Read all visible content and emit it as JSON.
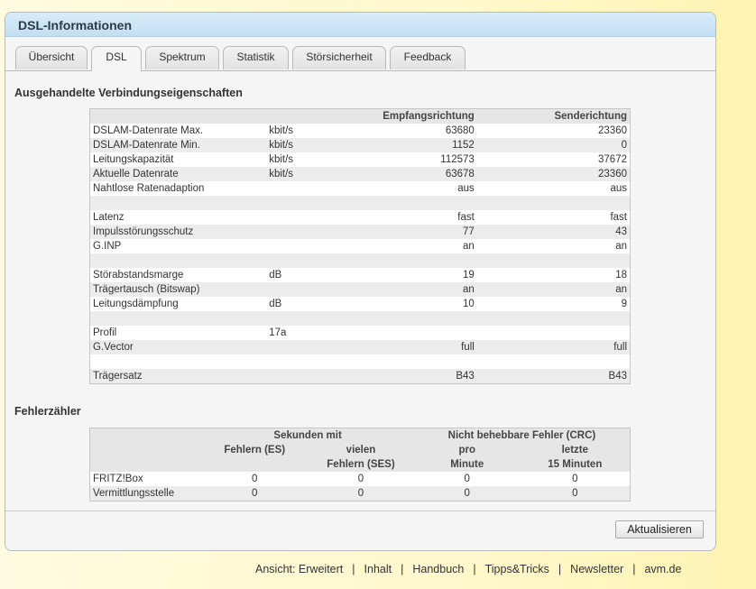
{
  "panel": {
    "title": "DSL-Informationen"
  },
  "tabs": [
    "Übersicht",
    "DSL",
    "Spektrum",
    "Statistik",
    "Störsicherheit",
    "Feedback"
  ],
  "section1": {
    "title": "Ausgehandelte Verbindungseigenschaften",
    "headers": [
      "",
      "",
      "Empfangsrichtung",
      "Senderichtung"
    ],
    "rows": [
      [
        "DSLAM-Datenrate Max.",
        "kbit/s",
        "63680",
        "23360"
      ],
      [
        "DSLAM-Datenrate Min.",
        "kbit/s",
        "1152",
        "0"
      ],
      [
        "Leitungskapazität",
        "kbit/s",
        "112573",
        "37672"
      ],
      [
        "Aktuelle Datenrate",
        "kbit/s",
        "63678",
        "23360"
      ],
      [
        "Nahtlose Ratenadaption",
        "",
        "aus",
        "aus"
      ],
      [
        "",
        "",
        "",
        ""
      ],
      [
        "Latenz",
        "",
        "fast",
        "fast"
      ],
      [
        "Impulsstörungsschutz",
        "",
        "77",
        "43"
      ],
      [
        "G.INP",
        "",
        "an",
        "an"
      ],
      [
        "",
        "",
        "",
        ""
      ],
      [
        "Störabstandsmarge",
        "dB",
        "19",
        "18"
      ],
      [
        "Trägertausch (Bitswap)",
        "",
        "an",
        "an"
      ],
      [
        "Leitungsdämpfung",
        "dB",
        "10",
        "9"
      ],
      [
        "",
        "",
        "",
        ""
      ],
      [
        "Profil",
        "17a",
        "",
        ""
      ],
      [
        "G.Vector",
        "",
        "full",
        "full"
      ],
      [
        "",
        "",
        "",
        ""
      ],
      [
        "Trägersatz",
        "",
        "B43",
        "B43"
      ]
    ]
  },
  "section2": {
    "title": "Fehlerzähler",
    "group_headers": [
      "Sekunden mit",
      "Nicht behebbare Fehler (CRC)"
    ],
    "sub_headers": [
      [
        "Fehlern (ES)",
        ""
      ],
      [
        "vielen",
        "Fehlern (SES)"
      ],
      [
        "pro",
        "Minute"
      ],
      [
        "letzte",
        "15 Minuten"
      ]
    ],
    "rows": [
      [
        "FRITZ!Box",
        "0",
        "0",
        "0",
        "0"
      ],
      [
        "Vermittlungsstelle",
        "0",
        "0",
        "0",
        "0"
      ]
    ]
  },
  "refresh_button": "Aktualisieren",
  "footer": {
    "items": [
      "Ansicht: Erweitert",
      "Inhalt",
      "Handbuch",
      "Tipps&Tricks",
      "Newsletter",
      "avm.de"
    ],
    "separator": "|"
  }
}
